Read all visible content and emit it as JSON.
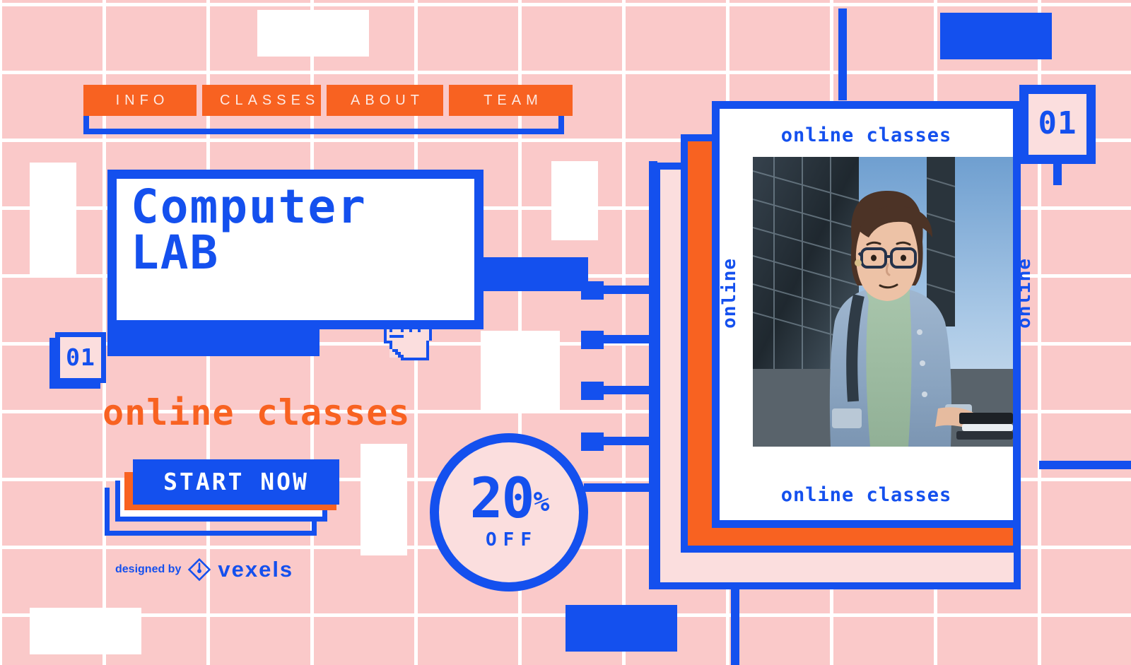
{
  "theme": {
    "background_pink": "#fac9c9",
    "light_pink": "#fbdede",
    "accent_blue": "#1450ee",
    "accent_orange": "#f86221",
    "white": "#ffffff"
  },
  "nav": {
    "items": [
      {
        "label": "INFO"
      },
      {
        "label": "CLASSES"
      },
      {
        "label": "ABOUT"
      },
      {
        "label": "TEAM"
      }
    ]
  },
  "hero": {
    "title_line1": "Computer",
    "title_line2": "LAB",
    "badge_number": "01",
    "subtitle": "online classes",
    "cta_label": "START NOW"
  },
  "discount": {
    "number": "20",
    "percent": "%",
    "off_label": "OFF"
  },
  "credit": {
    "prefix": "designed by",
    "brand": "vexels"
  },
  "showcase": {
    "badge_number": "01",
    "caption_top": "online classes",
    "caption_bottom": "online classes",
    "side_label_left": "online",
    "side_label_right": "online",
    "photo_alt": "woman in denim jacket holding laptop"
  }
}
